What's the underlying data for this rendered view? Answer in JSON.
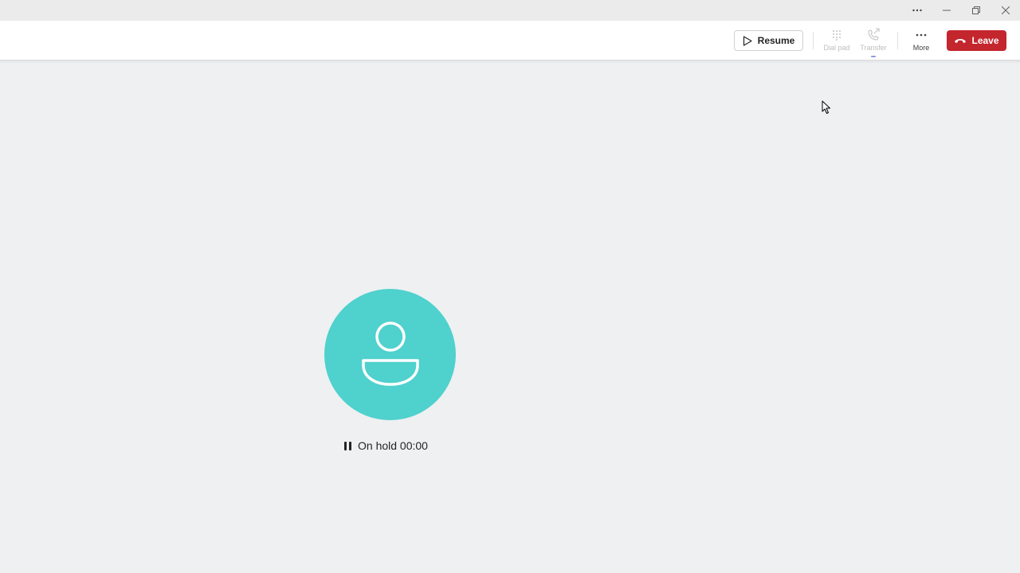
{
  "window": {
    "controls": [
      "more-options",
      "minimize",
      "restore",
      "close"
    ]
  },
  "toolbar": {
    "resume_label": "Resume",
    "dialpad_label": "Dial pad",
    "transfer_label": "Transfer",
    "more_label": "More",
    "leave_label": "Leave"
  },
  "call": {
    "status_text": "On hold 00:00"
  },
  "icons": {
    "resume": "play-icon",
    "dialpad": "dialpad-icon",
    "transfer": "phone-transfer-icon",
    "more": "ellipsis-icon",
    "leave": "phone-hangup-icon",
    "avatar": "person-icon",
    "status": "pause-icon"
  },
  "colors": {
    "leave_button": "#c4262e",
    "avatar_bg": "#4fd1cd",
    "stage_bg": "#eef0f2"
  }
}
